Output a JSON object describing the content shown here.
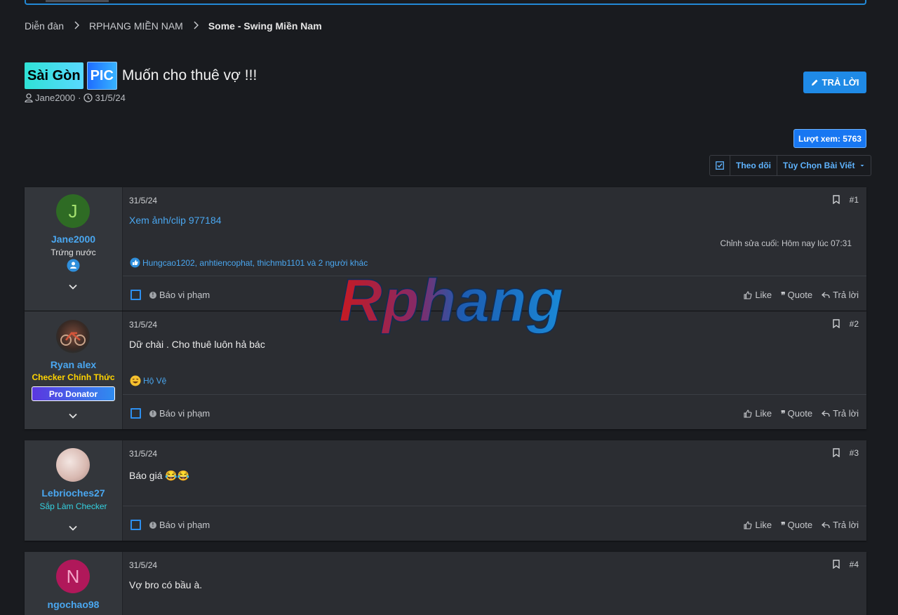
{
  "breadcrumb": {
    "items": [
      "Diễn đàn",
      "RPHANG MIỀN NAM"
    ],
    "current": "Some - Swing Miền Nam"
  },
  "thread": {
    "prefix1": "Sài Gòn",
    "prefix2": "PIC",
    "title": "Muốn cho thuê vợ !!!",
    "author": "Jane2000",
    "date": "31/5/24",
    "reply_label": "TRẢ LỜI",
    "views_label": "Lượt xem: 5763"
  },
  "toolbar": {
    "follow": "Theo dõi",
    "options": "Tùy Chọn Bài Viết"
  },
  "watermark": {
    "text": "Rphang"
  },
  "actions": {
    "report": "Báo vi phạm",
    "like": "Like",
    "quote": "Quote",
    "reply": "Trả lời"
  },
  "posts": [
    {
      "date": "31/5/24",
      "num": "#1",
      "user": {
        "initial": "J",
        "name": "Jane2000",
        "title": "Trứng nước",
        "avatar_color": "#2e6b24",
        "initial_color": "#a3e06e"
      },
      "link": "Xem ảnh/clip 977184",
      "edited": "Chỉnh sửa cuối: Hôm nay lúc 07:31",
      "reactions": "Hungcao1202, anhtiencophat, thichmb1101 và 2 người khác"
    },
    {
      "date": "31/5/24",
      "num": "#2",
      "user": {
        "name": "Ryan alex",
        "title": "Checker Chính Thức",
        "badge": "Pro Donator"
      },
      "body": "Dữ chài . Cho thuê luôn hả bác",
      "reactions": "Hộ Vệ"
    },
    {
      "date": "31/5/24",
      "num": "#3",
      "user": {
        "name": "Lebrioches27",
        "title": "Sắp Làm Checker"
      },
      "body": "Báo giá 😂😂"
    },
    {
      "date": "31/5/24",
      "num": "#4",
      "user": {
        "initial": "N",
        "name": "ngochao98",
        "avatar_color": "#b0185a",
        "initial_color": "#f4a6c9"
      },
      "body": "Vợ bro có bầu à."
    }
  ]
}
